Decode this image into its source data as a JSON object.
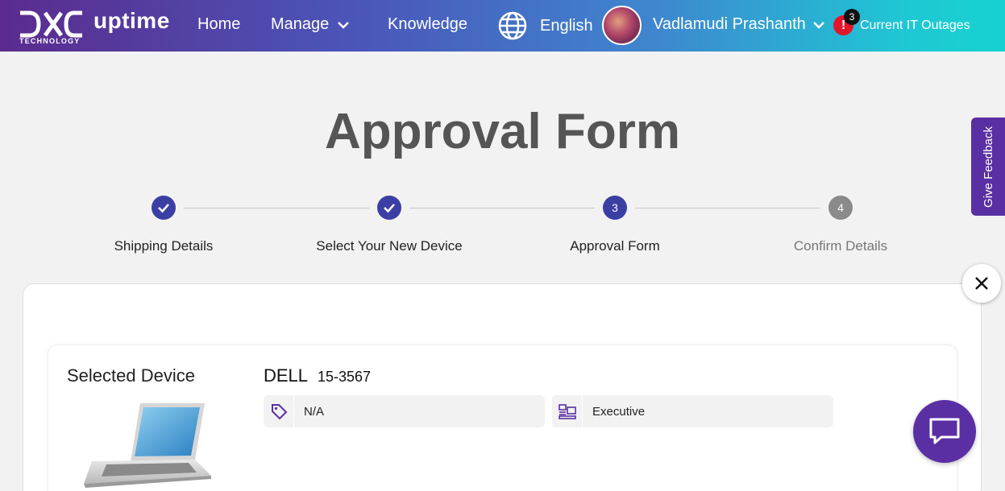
{
  "header": {
    "logo_word": "TECHNOLOGY",
    "brand_name": "uptime",
    "nav": {
      "home": "Home",
      "manage": "Manage",
      "knowledge": "Knowledge"
    },
    "language": "English",
    "user_name": "Vadlamudi Prashanth",
    "alert_symbol": "!",
    "alert_count": "3",
    "outages_label": "Current IT Outages"
  },
  "page_title": "Approval Form",
  "stepper": {
    "steps": [
      {
        "number": "1",
        "label": "Shipping Details",
        "state": "done"
      },
      {
        "number": "2",
        "label": "Select Your New Device",
        "state": "done"
      },
      {
        "number": "3",
        "label": "Approval Form",
        "state": "active"
      },
      {
        "number": "4",
        "label": "Confirm Details",
        "state": "future"
      }
    ]
  },
  "feedback_label": "Give Feedback",
  "device": {
    "section_label": "Selected Device",
    "brand": "DELL",
    "model": "15-3567",
    "price_tag": "N/A",
    "category": "Executive"
  },
  "colors": {
    "accent": "#3b3fa3",
    "brand_purple": "#5a2fa3",
    "alert_red": "#e3152a"
  },
  "icons": [
    "globe-icon",
    "chevron-down-icon",
    "check-icon",
    "close-icon",
    "tag-icon",
    "executive-icon",
    "chat-icon"
  ]
}
